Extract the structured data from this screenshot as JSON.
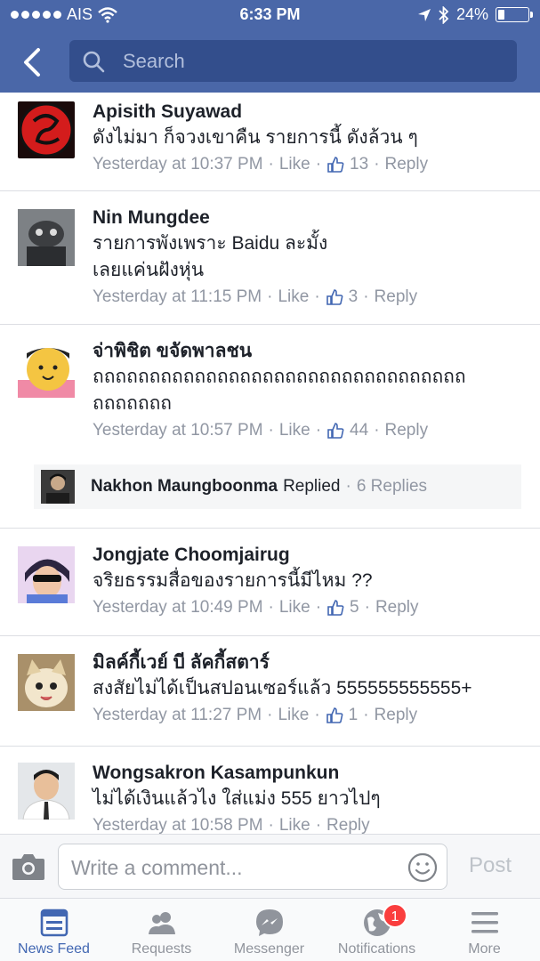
{
  "status_bar": {
    "carrier": "AIS",
    "time": "6:33 PM",
    "battery": "24%",
    "battery_level": 0.24
  },
  "search": {
    "placeholder": "Search"
  },
  "comments": [
    {
      "name": "Apisith Suyawad",
      "text": "ดังไม่มา ก็จวงเขาคืน รายการนี้ ดังล้วน ๆ",
      "time": "Yesterday at 10:37 PM",
      "like": "Like",
      "likes": "13",
      "reply": "Reply"
    },
    {
      "name": "Nin Mungdee",
      "text": "รายการพังเพราะ Baidu ละมั้ง\nเลยแค่นฝังหุ่น",
      "time": "Yesterday at 11:15 PM",
      "like": "Like",
      "likes": "3",
      "reply": "Reply"
    },
    {
      "name": "จ่าพิชิต ขจัดพาลชน",
      "text": "ถถถถถถถถถถถถถถถถถถถถถถถถถถถถถถถถถ\nถถถถถถถ",
      "time": "Yesterday at 10:57 PM",
      "like": "Like",
      "likes": "44",
      "reply": "Reply",
      "replied": {
        "name": "Nakhon Maungboonma",
        "word": "Replied",
        "count": "6 Replies"
      }
    },
    {
      "name": "Jongjate Choomjairug",
      "text": "จริยธรรมสื่อของรายการนี้มีไหม ??",
      "time": "Yesterday at 10:49 PM",
      "like": "Like",
      "likes": "5",
      "reply": "Reply"
    },
    {
      "name": "มิลค์กี้เวย์ บี ลัคกี้สตาร์",
      "text": "สงสัยไม่ได้เป็นสปอนเซอร์แล้ว 555555555555+",
      "time": "Yesterday at 11:27 PM",
      "like": "Like",
      "likes": "1",
      "reply": "Reply"
    },
    {
      "name": "Wongsakron Kasampunkun",
      "text": "ไม่ได้เงินแล้วไง ใส่แม่ง 555 ยาวไปๆ",
      "time": "Yesterday at 10:58 PM",
      "like": "Like",
      "reply": "Reply"
    }
  ],
  "composer": {
    "placeholder": "Write a comment...",
    "post_label": "Post"
  },
  "tabs": [
    {
      "label": "News Feed",
      "icon": "news-feed-icon"
    },
    {
      "label": "Requests",
      "icon": "requests-icon"
    },
    {
      "label": "Messenger",
      "icon": "messenger-icon"
    },
    {
      "label": "Notifications",
      "icon": "notifications-icon",
      "badge": "1"
    },
    {
      "label": "More",
      "icon": "more-icon"
    }
  ],
  "colors": {
    "brand": "#4a67a8",
    "link": "#4267b2",
    "badge": "#fa3e3e",
    "meta": "#9197a3"
  }
}
